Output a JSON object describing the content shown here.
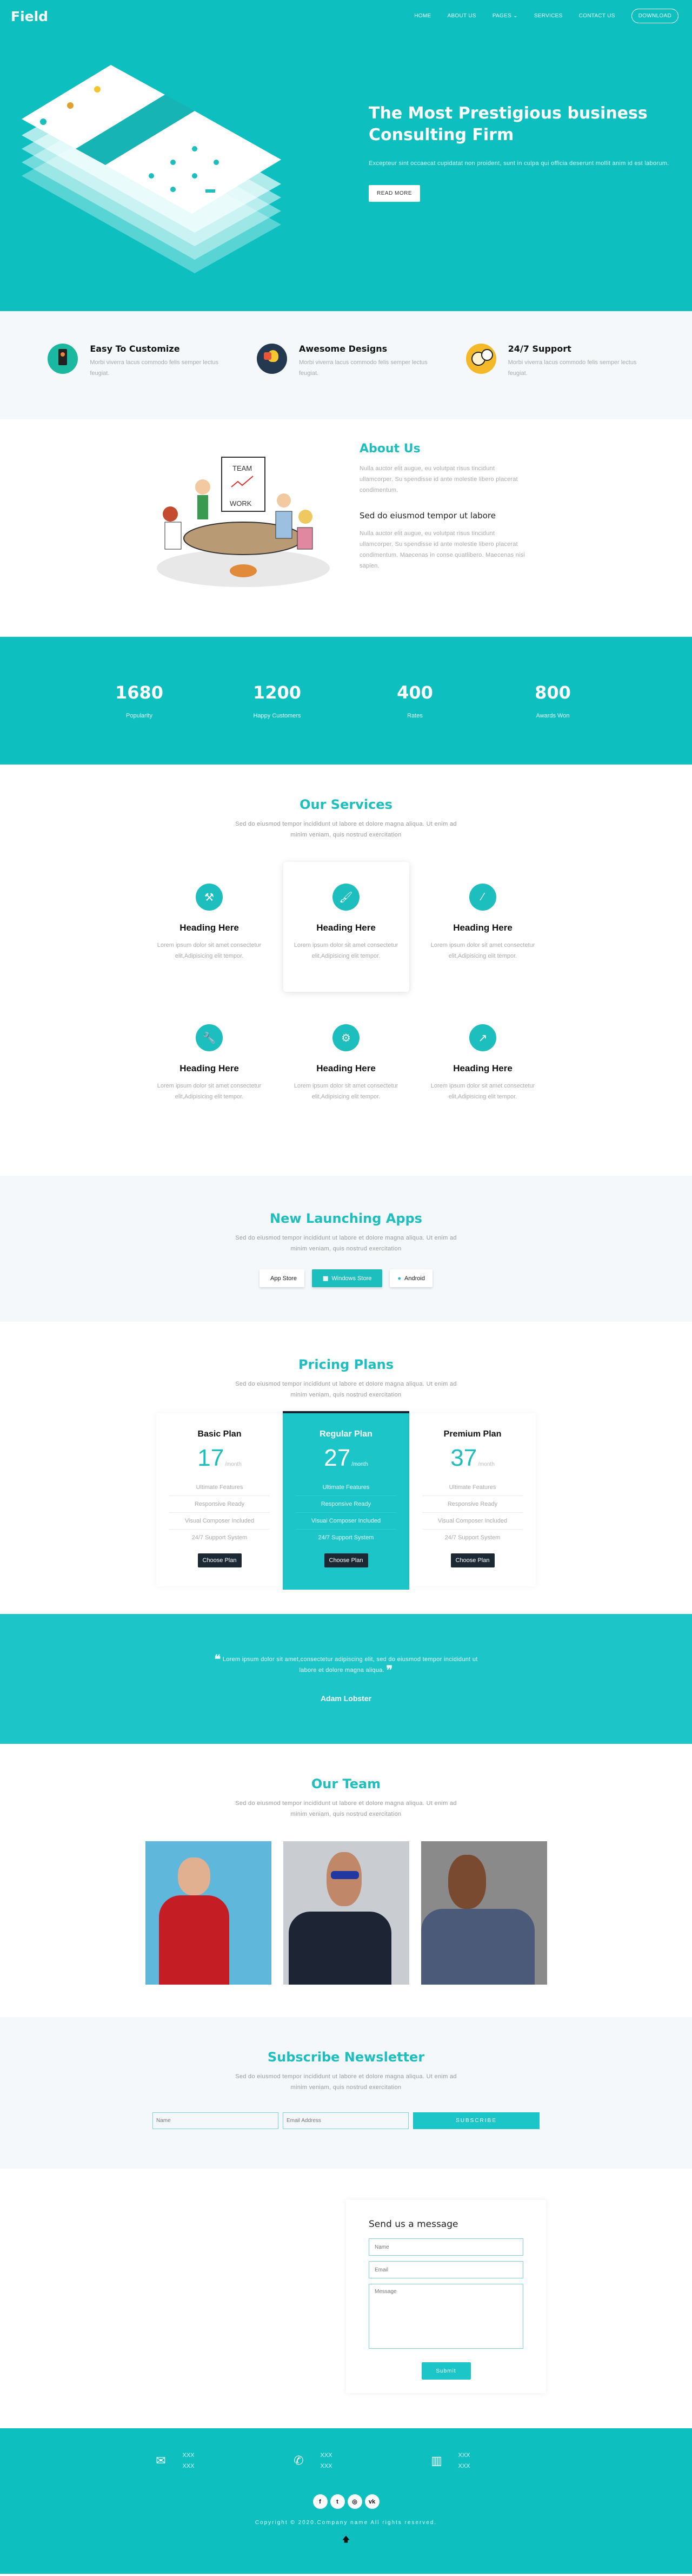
{
  "brand": {
    "logo": "Field",
    "accent": "#1cbfbd",
    "dark": "#1c2833"
  },
  "nav": {
    "items": [
      "HOME",
      "ABOUT US",
      "PAGES",
      "SERVICES",
      "CONTACT US"
    ],
    "pages_caret": "⌄",
    "download": "DOWNLOAD"
  },
  "hero": {
    "title": "The Most Prestigious business Consulting Firm",
    "text": "Excepteur sint occaecat cupidatat non proident, sunt in culpa qui officia deserunt mollit anim id est laborum.",
    "button": "READ MORE"
  },
  "features": [
    {
      "title": "Easy To Customize",
      "text": "Morbi viverra lacus commodo felis semper lectus feugiat.",
      "icon": "mobile-touch-icon"
    },
    {
      "title": "Awesome Designs",
      "text": "Morbi viverra lacus commodo felis semper lectus feugiat.",
      "icon": "lightbulb-gear-icon"
    },
    {
      "title": "24/7 Support",
      "text": "Morbi viverra lacus commodo felis semper lectus feugiat.",
      "icon": "stopwatch-clock-icon"
    }
  ],
  "about": {
    "title": "About Us",
    "text1": "Nulla auctor elit augue, eu volutpat risus tincidunt ullamcorper. Su spendisse id ante molestie libero placerat condimentum.",
    "subtitle": "Sed do eiusmod tempor ut labore",
    "text2": "Nulla auctor elit augue, eu volutpat risus tincidunt ullamcorper. Su spendisse id ante molestie libero placerat condimentum. Maecenas in conse quatlibero. Maecenas nisi sapien.",
    "illustration_words": [
      "TEAM",
      "WORK"
    ]
  },
  "stats": [
    {
      "value": "1680",
      "label": "Popularity"
    },
    {
      "value": "1200",
      "label": "Happy Customers"
    },
    {
      "value": "400",
      "label": "Rates"
    },
    {
      "value": "800",
      "label": "Awards Won"
    }
  ],
  "services": {
    "title": "Our Services",
    "subtitle": "Sed do eiusmod tempor incididunt ut labore et dolore magna aliqua. Ut enim ad minim veniam, quis nostrud exercitation",
    "items": [
      {
        "heading": "Heading Here",
        "text": "Lorem ipsum dolor sit amet consectetur elit,Adipisicing elit tempor.",
        "icon": "gavel-icon",
        "glyph": "⚒"
      },
      {
        "heading": "Heading Here",
        "text": "Lorem ipsum dolor sit amet consectetur elit,Adipisicing elit tempor.",
        "icon": "paint-brush-icon",
        "glyph": "🖌"
      },
      {
        "heading": "Heading Here",
        "text": "Lorem ipsum dolor sit amet consectetur elit,Adipisicing elit tempor.",
        "icon": "magic-wand-icon",
        "glyph": "⁄"
      },
      {
        "heading": "Heading Here",
        "text": "Lorem ipsum dolor sit amet consectetur elit,Adipisicing elit tempor.",
        "icon": "wrench-icon",
        "glyph": "🔧"
      },
      {
        "heading": "Heading Here",
        "text": "Lorem ipsum dolor sit amet consectetur elit,Adipisicing elit tempor.",
        "icon": "gears-icon",
        "glyph": "⚙"
      },
      {
        "heading": "Heading Here",
        "text": "Lorem ipsum dolor sit amet consectetur elit,Adipisicing elit tempor.",
        "icon": "line-chart-icon",
        "glyph": "↗"
      }
    ]
  },
  "apps": {
    "title": "New Launching Apps",
    "subtitle": "Sed do eiusmod tempor incididunt ut labore et dolore magna aliqua. Ut enim ad minim veniam, quis nostrud exercitation",
    "buttons": [
      {
        "label": "App Store",
        "glyph": ""
      },
      {
        "label": "Windows Store",
        "glyph": "▦"
      },
      {
        "label": "Android",
        "glyph": "●"
      }
    ]
  },
  "pricing": {
    "title": "Pricing Plans",
    "subtitle": "Sed do eiusmod tempor incididunt ut labore et dolore magna aliqua. Ut enim ad minim veniam, quis nostrud exercitation",
    "plans": [
      {
        "name": "Basic Plan",
        "price": "17",
        "per": "/month",
        "features": [
          "Ultimate Features",
          "Responsive Ready",
          "Visual Composer Included",
          "24/7 Support System"
        ],
        "button": "Choose Plan"
      },
      {
        "name": "Regular Plan",
        "price": "27",
        "per": "/month",
        "features": [
          "Ultimate Features",
          "Responsive Ready",
          "Visual Composer Included",
          "24/7 Support System"
        ],
        "button": "Choose Plan"
      },
      {
        "name": "Premium Plan",
        "price": "37",
        "per": "/month",
        "features": [
          "Ultimate Features",
          "Responsive Ready",
          "Visual Composer Included",
          "24/7 Support System"
        ],
        "button": "Choose Plan"
      }
    ]
  },
  "testimonial": {
    "open": "❝",
    "close": "❞",
    "quote": "Lorem ipsum dolor sit amet,consectetur adipiscing elit, sed do eiusmod tempor incididunt ut labore et dolore magna aliqua.",
    "author": "Adam Lobster"
  },
  "team": {
    "title": "Our Team",
    "subtitle": "Sed do eiusmod tempor incididunt ut labore et dolore magna aliqua. Ut enim ad minim veniam, quis nostrud exercitation"
  },
  "subscribe": {
    "title": "Subscribe Newsletter",
    "subtitle": "Sed do eiusmod tempor incididunt ut labore et dolore magna aliqua. Ut enim ad minim veniam, quis nostrud exercitation",
    "name_placeholder": "Name",
    "email_placeholder": "Email Address",
    "button": "SUBSCRIBE"
  },
  "contact": {
    "title": "Send us a message",
    "name_placeholder": "Name",
    "email_placeholder": "Email",
    "message_placeholder": "Message",
    "button": "Submit"
  },
  "footer": {
    "info": [
      {
        "icon": "envelope-icon",
        "glyph": "✉",
        "lines": [
          "XXX",
          "XXX"
        ]
      },
      {
        "icon": "phone-icon",
        "glyph": "✆",
        "lines": [
          "XXX",
          "XXX"
        ]
      },
      {
        "icon": "map-icon",
        "glyph": "▥",
        "lines": [
          "XXX",
          "XXX"
        ]
      }
    ],
    "social": [
      {
        "icon": "facebook-icon",
        "glyph": "f"
      },
      {
        "icon": "twitter-icon",
        "glyph": "t"
      },
      {
        "icon": "dribbble-icon",
        "glyph": "◎"
      },
      {
        "icon": "vk-icon",
        "glyph": "vk"
      }
    ],
    "copyright": "Copyright © 2020.Company name All rights reserved.",
    "back_to_top": "🡅"
  }
}
